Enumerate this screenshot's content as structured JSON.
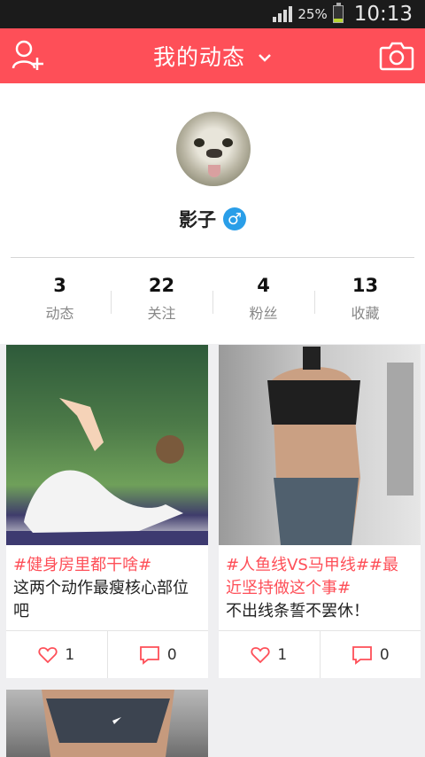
{
  "status": {
    "battery": "25%",
    "time": "10:13",
    "battery_level": 0.25,
    "signal_bars": 4
  },
  "header": {
    "title": "我的动态"
  },
  "profile": {
    "username": "影子",
    "gender_symbol": "♂"
  },
  "stats": [
    {
      "value": "3",
      "label": "动态"
    },
    {
      "value": "22",
      "label": "关注"
    },
    {
      "value": "4",
      "label": "粉丝"
    },
    {
      "value": "13",
      "label": "收藏"
    }
  ],
  "posts": [
    {
      "tag": "#健身房里都干啥#",
      "text": "这两个动作最瘦核心部位吧",
      "likes": "1",
      "comments": "0"
    },
    {
      "tag": "#人鱼线VS马甲线##最近坚持做这个事#",
      "text": "不出线条誓不罢休！",
      "likes": "1",
      "comments": "0"
    }
  ],
  "colors": {
    "accent": "#fe4f58",
    "gender": "#2a9ee8"
  }
}
